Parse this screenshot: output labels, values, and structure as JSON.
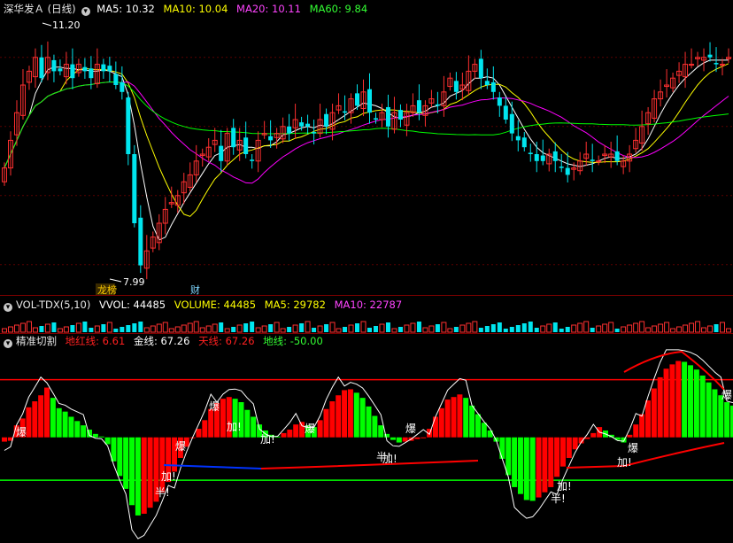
{
  "colors": {
    "bg": "#000000",
    "up": "#ff3030",
    "down": "#00e5ee",
    "ma5": "#ffffff",
    "ma10": "#ffff00",
    "ma20": "#ff00ff",
    "ma60": "#00ff00",
    "hist_red": "#ff0000",
    "hist_green": "#00ff00",
    "line_blue": "#0033ff"
  },
  "main_legend": {
    "title": "深华发Ａ (日线)",
    "ma5": "MA5: 10.32",
    "ma10": "MA10: 10.04",
    "ma20": "MA20: 10.11",
    "ma60": "MA60: 9.84"
  },
  "vol_legend": {
    "name": "VOL-TDX(5,10)",
    "vvol": "VVOL: 44485",
    "volume": "VOLUME: 44485",
    "ma5": "MA5: 29782",
    "ma10": "MA10: 22787"
  },
  "ind_legend": {
    "name": "精准切割",
    "dihong": "地红线: 6.61",
    "jin": "金线: 67.26",
    "tian": "天线: 67.26",
    "di": "地线: -50.00"
  },
  "annotations": {
    "high_label": "11.20",
    "low_label": "7.99",
    "badge1": "龙榜",
    "badge2": "财",
    "bao": "爆",
    "jia": "加!",
    "ban": "半!"
  },
  "chart_data": [
    {
      "type": "candlestick",
      "title": "深华发Ａ (日线)",
      "ylim": [
        7.6,
        11.6
      ],
      "high": 11.2,
      "low": 7.99,
      "closes": [
        9.4,
        9.8,
        10.2,
        10.6,
        10.8,
        11.0,
        10.7,
        11.0,
        10.8,
        10.8,
        10.9,
        10.7,
        10.9,
        10.8,
        10.7,
        10.9,
        10.8,
        10.8,
        10.6,
        10.5,
        9.6,
        8.6,
        7.99,
        8.2,
        8.4,
        8.6,
        8.8,
        8.9,
        9.0,
        9.2,
        9.3,
        9.5,
        9.6,
        9.7,
        9.8,
        9.5,
        9.9,
        9.7,
        9.8,
        9.6,
        9.5,
        9.8,
        9.9,
        9.8,
        9.9,
        10.0,
        9.9,
        10.1,
        10.0,
        10.0,
        9.9,
        10.1,
        10.0,
        10.2,
        10.3,
        10.2,
        10.4,
        10.3,
        10.5,
        10.2,
        10.1,
        10.2,
        10.0,
        10.2,
        10.1,
        10.2,
        10.3,
        10.2,
        10.3,
        10.4,
        10.3,
        10.5,
        10.7,
        10.5,
        10.6,
        10.8,
        10.9,
        10.7,
        10.6,
        10.5,
        10.3,
        10.1,
        9.9,
        9.8,
        9.7,
        9.6,
        9.5,
        9.5,
        9.6,
        9.5,
        9.4,
        9.3,
        9.4,
        9.5,
        9.6,
        9.5,
        9.5,
        9.6,
        9.6,
        9.5,
        9.5,
        9.6,
        9.8,
        10.0,
        10.2,
        10.4,
        10.5,
        10.6,
        10.7,
        10.8,
        10.9,
        10.9,
        11.0,
        11.0,
        11.0,
        10.9,
        10.9,
        11.0
      ],
      "series": [
        {
          "name": "MA5",
          "value": 10.32
        },
        {
          "name": "MA10",
          "value": 10.04
        },
        {
          "name": "MA20",
          "value": 10.11
        },
        {
          "name": "MA60",
          "value": 9.84
        }
      ]
    },
    {
      "type": "bar",
      "title": "VOL-TDX(5,10)",
      "volume_latest": 44485,
      "series": [
        {
          "name": "VVOL",
          "value": 44485
        },
        {
          "name": "VOLUME",
          "value": 44485
        },
        {
          "name": "MA5",
          "value": 29782
        },
        {
          "name": "MA10",
          "value": 22787
        }
      ]
    },
    {
      "type": "bar",
      "title": "精准切割",
      "ylim": [
        -120,
        105
      ],
      "hist": [
        -5,
        -4,
        14,
        22,
        35,
        42,
        49,
        58,
        46,
        34,
        30,
        24,
        19,
        14,
        9,
        4,
        1,
        -8,
        -28,
        -45,
        -60,
        -79,
        -91,
        -89,
        -82,
        -75,
        -64,
        -52,
        -40,
        -24,
        -11,
        0,
        10,
        20,
        33,
        40,
        45,
        47,
        45,
        41,
        32,
        24,
        15,
        8,
        3,
        1,
        5,
        9,
        15,
        18,
        14,
        12,
        20,
        33,
        42,
        49,
        55,
        56,
        52,
        46,
        36,
        25,
        14,
        4,
        -3,
        -6,
        -5,
        -4,
        -2,
        0,
        10,
        24,
        34,
        44,
        47,
        50,
        46,
        37,
        27,
        17,
        8,
        -5,
        -25,
        -44,
        -58,
        -66,
        -73,
        -74,
        -70,
        -64,
        -58,
        -46,
        -34,
        -24,
        -14,
        -7,
        -2,
        5,
        12,
        8,
        3,
        -3,
        -6,
        3,
        15,
        27,
        43,
        57,
        70,
        80,
        85,
        89,
        88,
        84,
        79,
        72,
        64,
        56,
        49,
        41,
        37
      ],
      "lines": {
        "天线": 67.26,
        "地线": -50.0,
        "金线": 67.26,
        "地红线": 6.61
      }
    }
  ]
}
